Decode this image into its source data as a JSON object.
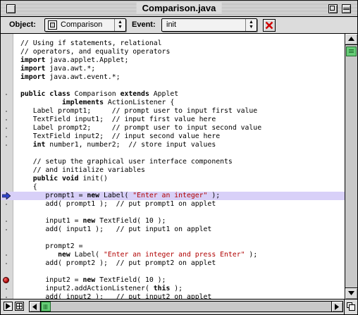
{
  "window": {
    "title": "Comparison.java"
  },
  "toolbar": {
    "object_label": "Object:",
    "object_value": "Comparison",
    "event_label": "Event:",
    "event_value": "init"
  },
  "scroll": {
    "vertical_position": 0.0,
    "horizontal_position": 0.0
  },
  "bottom": {
    "btn_a_icon": "play-triangle-icon",
    "btn_b_icon": "split-pane-icon"
  },
  "colors": {
    "highlight": "#d8d0f8",
    "string": "#b00000",
    "thumb": "#66cc77",
    "breakpoint": "#cc0000"
  },
  "code": {
    "lines": [
      {
        "marker": "none",
        "tokens": [
          {
            "t": "// Using if statements, relational",
            "k": "comment"
          }
        ]
      },
      {
        "marker": "none",
        "tokens": [
          {
            "t": "// operators, and equality operators",
            "k": "comment"
          }
        ]
      },
      {
        "marker": "none",
        "tokens": [
          {
            "t": "import",
            "k": "keyword"
          },
          {
            "t": " java.applet.Applet;",
            "k": "plain"
          }
        ]
      },
      {
        "marker": "none",
        "tokens": [
          {
            "t": "import",
            "k": "keyword"
          },
          {
            "t": " java.awt.*;",
            "k": "plain"
          }
        ]
      },
      {
        "marker": "none",
        "tokens": [
          {
            "t": "import",
            "k": "keyword"
          },
          {
            "t": " java.awt.event.*;",
            "k": "plain"
          }
        ]
      },
      {
        "marker": "none",
        "tokens": [
          {
            "t": "",
            "k": "plain"
          }
        ]
      },
      {
        "marker": "dot",
        "tokens": [
          {
            "t": "public class",
            "k": "keyword"
          },
          {
            "t": " Comparison ",
            "k": "plain"
          },
          {
            "t": "extends",
            "k": "keyword"
          },
          {
            "t": " Applet",
            "k": "plain"
          }
        ]
      },
      {
        "marker": "none",
        "tokens": [
          {
            "t": "          ",
            "k": "plain"
          },
          {
            "t": "implements",
            "k": "keyword"
          },
          {
            "t": " ActionListener {",
            "k": "plain"
          }
        ]
      },
      {
        "marker": "dot",
        "tokens": [
          {
            "t": "   Label prompt1;     ",
            "k": "plain"
          },
          {
            "t": "// prompt user to input first value",
            "k": "comment"
          }
        ]
      },
      {
        "marker": "dot",
        "tokens": [
          {
            "t": "   TextField input1;  ",
            "k": "plain"
          },
          {
            "t": "// input first value here",
            "k": "comment"
          }
        ]
      },
      {
        "marker": "dot",
        "tokens": [
          {
            "t": "   Label prompt2;     ",
            "k": "plain"
          },
          {
            "t": "// prompt user to input second value",
            "k": "comment"
          }
        ]
      },
      {
        "marker": "dot",
        "tokens": [
          {
            "t": "   TextField input2;  ",
            "k": "plain"
          },
          {
            "t": "// input second value here",
            "k": "comment"
          }
        ]
      },
      {
        "marker": "dot",
        "tokens": [
          {
            "t": "   ",
            "k": "plain"
          },
          {
            "t": "int",
            "k": "keyword"
          },
          {
            "t": " number1, number2;  ",
            "k": "plain"
          },
          {
            "t": "// store input values",
            "k": "comment"
          }
        ]
      },
      {
        "marker": "none",
        "tokens": [
          {
            "t": "",
            "k": "plain"
          }
        ]
      },
      {
        "marker": "none",
        "tokens": [
          {
            "t": "   // setup the graphical user interface components",
            "k": "comment"
          }
        ]
      },
      {
        "marker": "none",
        "tokens": [
          {
            "t": "   // and initialize variables",
            "k": "comment"
          }
        ]
      },
      {
        "marker": "none",
        "tokens": [
          {
            "t": "   ",
            "k": "plain"
          },
          {
            "t": "public void",
            "k": "keyword"
          },
          {
            "t": " init()",
            "k": "plain"
          }
        ]
      },
      {
        "marker": "none",
        "tokens": [
          {
            "t": "   {",
            "k": "plain"
          }
        ]
      },
      {
        "marker": "arrow",
        "highlight": true,
        "tokens": [
          {
            "t": "      prompt1 = ",
            "k": "plain"
          },
          {
            "t": "new",
            "k": "keyword"
          },
          {
            "t": " Label( ",
            "k": "plain"
          },
          {
            "t": "\"Enter an integer\"",
            "k": "string"
          },
          {
            "t": " );",
            "k": "plain"
          }
        ]
      },
      {
        "marker": "dot",
        "tokens": [
          {
            "t": "      add( prompt1 );  ",
            "k": "plain"
          },
          {
            "t": "// put prompt1 on applet",
            "k": "comment"
          }
        ]
      },
      {
        "marker": "none",
        "tokens": [
          {
            "t": "",
            "k": "plain"
          }
        ]
      },
      {
        "marker": "dot",
        "tokens": [
          {
            "t": "      input1 = ",
            "k": "plain"
          },
          {
            "t": "new",
            "k": "keyword"
          },
          {
            "t": " TextField( 10 );",
            "k": "plain"
          }
        ]
      },
      {
        "marker": "dot",
        "tokens": [
          {
            "t": "      add( input1 );   ",
            "k": "plain"
          },
          {
            "t": "// put input1 on applet",
            "k": "comment"
          }
        ]
      },
      {
        "marker": "none",
        "tokens": [
          {
            "t": "",
            "k": "plain"
          }
        ]
      },
      {
        "marker": "none",
        "tokens": [
          {
            "t": "      prompt2 =",
            "k": "plain"
          }
        ]
      },
      {
        "marker": "dot",
        "tokens": [
          {
            "t": "         ",
            "k": "plain"
          },
          {
            "t": "new",
            "k": "keyword"
          },
          {
            "t": " Label( ",
            "k": "plain"
          },
          {
            "t": "\"Enter an integer and press Enter\"",
            "k": "string"
          },
          {
            "t": " );",
            "k": "plain"
          }
        ]
      },
      {
        "marker": "dot",
        "tokens": [
          {
            "t": "      add( prompt2 );  ",
            "k": "plain"
          },
          {
            "t": "// put prompt2 on applet",
            "k": "comment"
          }
        ]
      },
      {
        "marker": "none",
        "tokens": [
          {
            "t": "",
            "k": "plain"
          }
        ]
      },
      {
        "marker": "breakpoint",
        "tokens": [
          {
            "t": "      input2 = ",
            "k": "plain"
          },
          {
            "t": "new",
            "k": "keyword"
          },
          {
            "t": " TextField( 10 );",
            "k": "plain"
          }
        ]
      },
      {
        "marker": "dot",
        "tokens": [
          {
            "t": "      input2.addActionListener( ",
            "k": "plain"
          },
          {
            "t": "this",
            "k": "keyword"
          },
          {
            "t": " );",
            "k": "plain"
          }
        ]
      },
      {
        "marker": "dot",
        "tokens": [
          {
            "t": "      add( input2 );   ",
            "k": "plain"
          },
          {
            "t": "// put input2 on applet",
            "k": "comment"
          }
        ]
      },
      {
        "marker": "dot",
        "tokens": [
          {
            "t": "   }",
            "k": "plain"
          }
        ]
      }
    ]
  }
}
